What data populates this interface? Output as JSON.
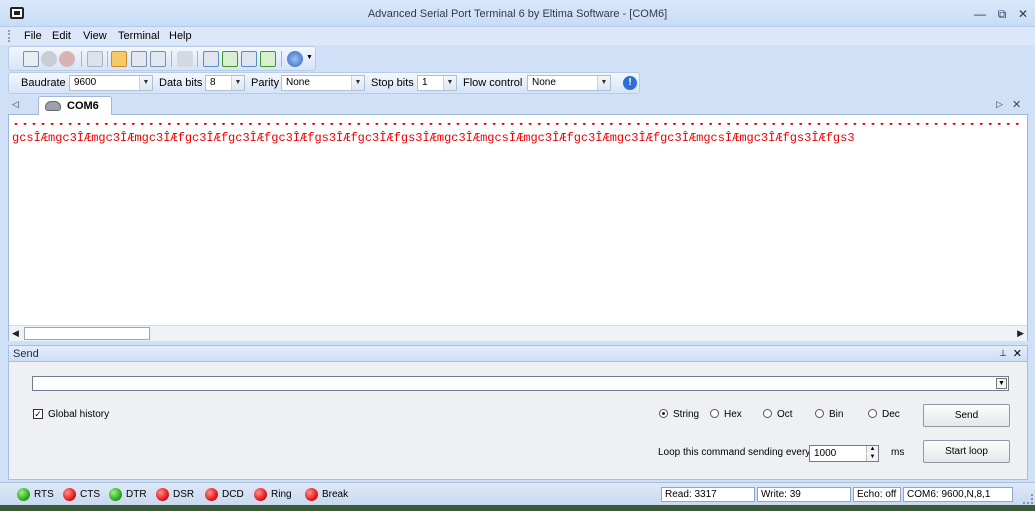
{
  "window": {
    "title": "Advanced Serial Port Terminal 6 by Eltima Software - [COM6]"
  },
  "menu": {
    "items": [
      "File",
      "Edit",
      "View",
      "Terminal",
      "Help"
    ]
  },
  "settings": {
    "baudrate_label": "Baudrate",
    "baudrate_value": "9600",
    "databits_label": "Data bits",
    "databits_value": "8",
    "parity_label": "Parity",
    "parity_value": "None",
    "stopbits_label": "Stop bits",
    "stopbits_value": "1",
    "flow_label": "Flow control",
    "flow_value": "None"
  },
  "tabs": {
    "active_label": "COM6"
  },
  "terminal": {
    "dots": "••••••••••••••••••••••••••••••••••••••••••••••••••••••••••••••••••••••••••••••••••••••••••••••••••••••••••••••••••••••••••••••••••••••••••••",
    "output": "gcsÎÆmgc3ÎÆmgc3ÎÆmgc3ÎÆfgc3ÎÆfgc3ÎÆfgc3ÎÆfgs3ÎÆfgc3ÎÆfgs3ÎÆmgc3ÎÆmgcsÎÆmgc3ÎÆfgc3ÎÆmgc3ÎÆfgc3ÎÆmgcsÎÆmgc3ÎÆfgs3ÎÆfgs3"
  },
  "send": {
    "title": "Send",
    "input_value": "",
    "global_history_label": "Global history",
    "global_history_checked": true,
    "formats": [
      "String",
      "Hex",
      "Oct",
      "Bin",
      "Dec"
    ],
    "selected_format": "String",
    "send_button": "Send",
    "loop_label": "Loop this command sending every",
    "loop_value": "1000",
    "ms_label": "ms",
    "start_loop_button": "Start loop"
  },
  "status": {
    "signals": [
      {
        "name": "RTS",
        "state": "green"
      },
      {
        "name": "CTS",
        "state": "red"
      },
      {
        "name": "DTR",
        "state": "green"
      },
      {
        "name": "DSR",
        "state": "red"
      },
      {
        "name": "DCD",
        "state": "red"
      },
      {
        "name": "Ring",
        "state": "red"
      },
      {
        "name": "Break",
        "state": "red"
      }
    ],
    "read": "Read:  3317",
    "write": "Write:  39",
    "echo": "Echo: off",
    "port": "COM6: 9600,N,8,1"
  },
  "colors": {
    "terminal_text": "#e00000",
    "led_green": "#23a814",
    "led_red": "#e01414"
  }
}
